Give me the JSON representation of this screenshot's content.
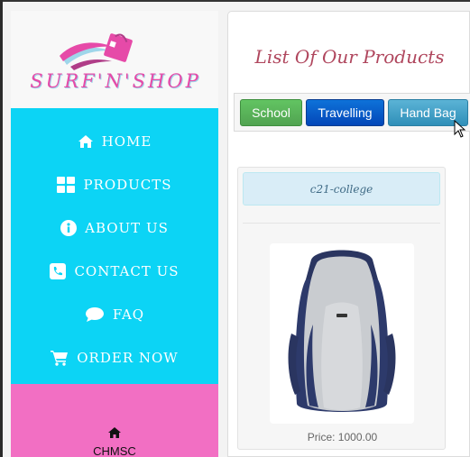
{
  "brand": {
    "logo_text": "SURF'N'SHOP"
  },
  "nav": {
    "items": [
      {
        "label": "HOME",
        "icon": "home-icon"
      },
      {
        "label": "PRODUCTS",
        "icon": "grid-icon"
      },
      {
        "label": "ABOUT US",
        "icon": "info-icon"
      },
      {
        "label": "CONTACT US",
        "icon": "phone-icon"
      },
      {
        "label": "FAQ",
        "icon": "chat-icon"
      },
      {
        "label": "ORDER NOW",
        "icon": "cart-icon"
      }
    ]
  },
  "footer": {
    "label": "CHMSC",
    "icon": "home-icon"
  },
  "main": {
    "title": "List Of Our Products",
    "tabs": [
      {
        "label": "School"
      },
      {
        "label": "Travelling"
      },
      {
        "label": "Hand Bag"
      }
    ],
    "product": {
      "name": "c21-college",
      "price": "Price: 1000.00"
    }
  },
  "colors": {
    "nav_bg": "#0cd4f5",
    "footer_bg": "#f26fc3",
    "title": "#b0475e",
    "tab_school": "#5cb85c",
    "tab_travelling": "#0a5fd0",
    "tab_handbag": "#3fa0c8"
  }
}
